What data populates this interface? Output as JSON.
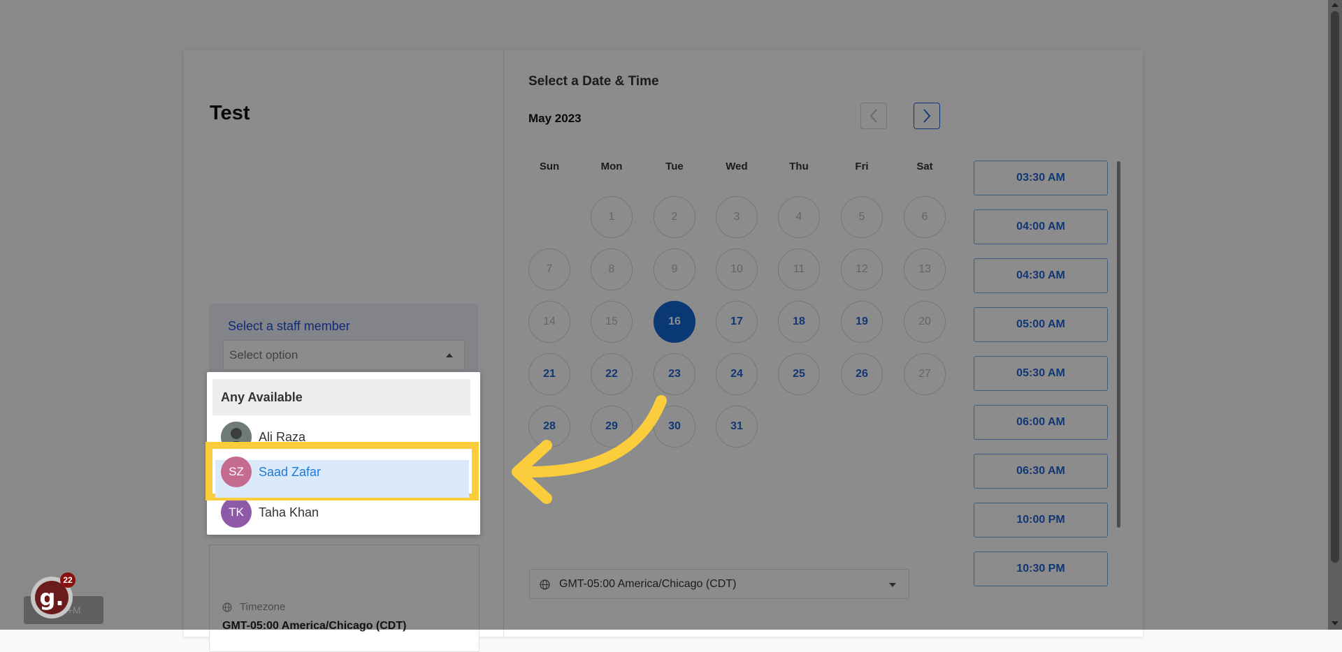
{
  "event": {
    "title": "Test"
  },
  "staff": {
    "label": "Select a staff member",
    "placeholder": "Select option"
  },
  "dropdown": {
    "options": [
      {
        "name": "Any Available"
      },
      {
        "name": "Ali Raza",
        "initials": ""
      },
      {
        "name": "Saad Zafar",
        "initials": "SZ",
        "color": "#c56b8d"
      },
      {
        "name": "Taha Khan",
        "initials": "TK",
        "color": "#8e5aa8"
      }
    ]
  },
  "timezone_left": {
    "label": "Timezone",
    "value": "GMT-05:00 America/Chicago (CDT)"
  },
  "calendar": {
    "section_title": "Select a Date & Time",
    "month": "May 2023",
    "weekdays": [
      "Sun",
      "Mon",
      "Tue",
      "Wed",
      "Thu",
      "Fri",
      "Sat"
    ],
    "selected_day": "16",
    "days": [
      "1",
      "2",
      "3",
      "4",
      "5",
      "6",
      "7",
      "8",
      "9",
      "10",
      "11",
      "12",
      "13",
      "14",
      "15",
      "16",
      "17",
      "18",
      "19",
      "20",
      "21",
      "22",
      "23",
      "24",
      "25",
      "26",
      "27",
      "28",
      "29",
      "30",
      "31"
    ],
    "available_days": [
      "17",
      "18",
      "19",
      "21",
      "22",
      "23",
      "24",
      "25",
      "26",
      "28",
      "29",
      "30",
      "31"
    ]
  },
  "times": [
    "03:30 AM",
    "04:00 AM",
    "04:30 AM",
    "05:00 AM",
    "05:30 AM",
    "06:00 AM",
    "06:30 AM",
    "10:00 PM",
    "10:30 PM"
  ],
  "timezone_select": {
    "value": "GMT-05:00 America/Chicago (CDT)"
  },
  "guide": {
    "logo": "g.",
    "count": "22",
    "shortcut": "Ctrl+M"
  },
  "colors": {
    "accent": "#1f63d4",
    "highlight": "#fbcd3d",
    "selected": "#1366d6"
  }
}
